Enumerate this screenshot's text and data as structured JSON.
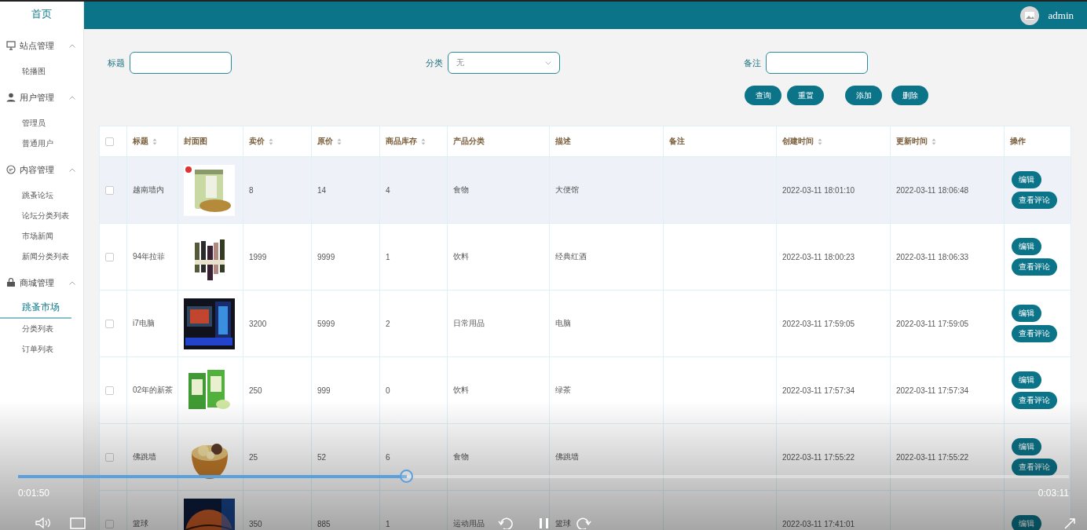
{
  "sidebar": {
    "home": "首页",
    "groups": [
      {
        "title": "站点管理",
        "expanded": true,
        "items": [
          {
            "label": "轮播图",
            "selected": false
          }
        ]
      },
      {
        "title": "用户管理",
        "expanded": true,
        "items": [
          {
            "label": "管理员",
            "selected": false
          },
          {
            "label": "普通用户",
            "selected": false
          }
        ]
      },
      {
        "title": "内容管理",
        "expanded": true,
        "items": [
          {
            "label": "跳蚤论坛",
            "selected": false
          },
          {
            "label": "论坛分类列表",
            "selected": false
          },
          {
            "label": "市场新闻",
            "selected": false
          },
          {
            "label": "新闻分类列表",
            "selected": false
          }
        ]
      },
      {
        "title": "商城管理",
        "expanded": true,
        "items": [
          {
            "label": "跳蚤市场",
            "selected": true
          },
          {
            "label": "分类列表",
            "selected": false
          },
          {
            "label": "订单列表",
            "selected": false
          }
        ]
      }
    ]
  },
  "header": {
    "user": "admin"
  },
  "filters": [
    {
      "kind": "input",
      "label": "标题"
    },
    {
      "kind": "select",
      "label": "分类",
      "value": "无"
    },
    {
      "kind": "input",
      "label": "备注"
    }
  ],
  "actions": [
    {
      "label": "查询"
    },
    {
      "label": "重置"
    },
    {
      "label": "添加"
    },
    {
      "label": "删除"
    }
  ],
  "table": {
    "select_all": {
      "checked": false
    },
    "columns": [
      {
        "label": "标题",
        "sortable": true
      },
      {
        "label": "封面图",
        "sortable": false
      },
      {
        "label": "卖价",
        "sortable": true
      },
      {
        "label": "原价",
        "sortable": true
      },
      {
        "label": "商品库存",
        "sortable": true
      },
      {
        "label": "产品分类",
        "sortable": false
      },
      {
        "label": "描述",
        "sortable": false
      },
      {
        "label": "备注",
        "sortable": false
      },
      {
        "label": "创建时间",
        "sortable": true
      },
      {
        "label": "更新时间",
        "sortable": true
      },
      {
        "label": "操作",
        "sortable": false
      }
    ],
    "rows": [
      {
        "checked": false,
        "highlighted": true,
        "cells": [
          "越南墙内",
          {
            "kind": "picture"
          },
          "8",
          "14",
          "4",
          "食物",
          "大便馆",
          "",
          "2022-03-11 18:01:10",
          "2022-03-11 18:06:48"
        ],
        "ops": [
          "编辑",
          "查看评论"
        ]
      },
      {
        "checked": false,
        "highlighted": false,
        "cells": [
          "94年拉菲",
          {
            "kind": "picture"
          },
          "1999",
          "9999",
          "1",
          "饮料",
          "经典红酒",
          "",
          "2022-03-11 18:00:23",
          "2022-03-11 18:06:33"
        ],
        "ops": [
          "编辑",
          "查看评论"
        ]
      },
      {
        "checked": false,
        "highlighted": false,
        "cells": [
          "i7电脑",
          {
            "kind": "picture"
          },
          "3200",
          "5999",
          "2",
          "日常用品",
          "电脑",
          "",
          "2022-03-11 17:59:05",
          "2022-03-11 17:59:05"
        ],
        "ops": [
          "编辑",
          "查看评论"
        ]
      },
      {
        "checked": false,
        "highlighted": false,
        "cells": [
          "02年的新茶",
          {
            "kind": "picture"
          },
          "250",
          "999",
          "0",
          "饮料",
          "绿茶",
          "",
          "2022-03-11 17:57:34",
          "2022-03-11 17:57:34"
        ],
        "ops": [
          "编辑",
          "查看评论"
        ]
      },
      {
        "checked": false,
        "highlighted": false,
        "cells": [
          "佛跳墙",
          {
            "kind": "picture"
          },
          "25",
          "52",
          "6",
          "食物",
          "佛跳墙",
          "",
          "2022-03-11 17:55:22",
          "2022-03-11 17:55:22"
        ],
        "ops": [
          "编辑",
          "查看评论"
        ]
      },
      {
        "checked": false,
        "highlighted": false,
        "cells": [
          "篮球",
          {
            "kind": "picture"
          },
          "350",
          "885",
          "1",
          "运动用品",
          "篮球",
          "",
          "2022-03-11 17:41:01",
          ""
        ],
        "ops": [
          "编辑"
        ]
      }
    ]
  },
  "player": {
    "elapsed": "0:01:50",
    "total": "0:03:11",
    "progress": {
      "level": 0.37
    }
  }
}
